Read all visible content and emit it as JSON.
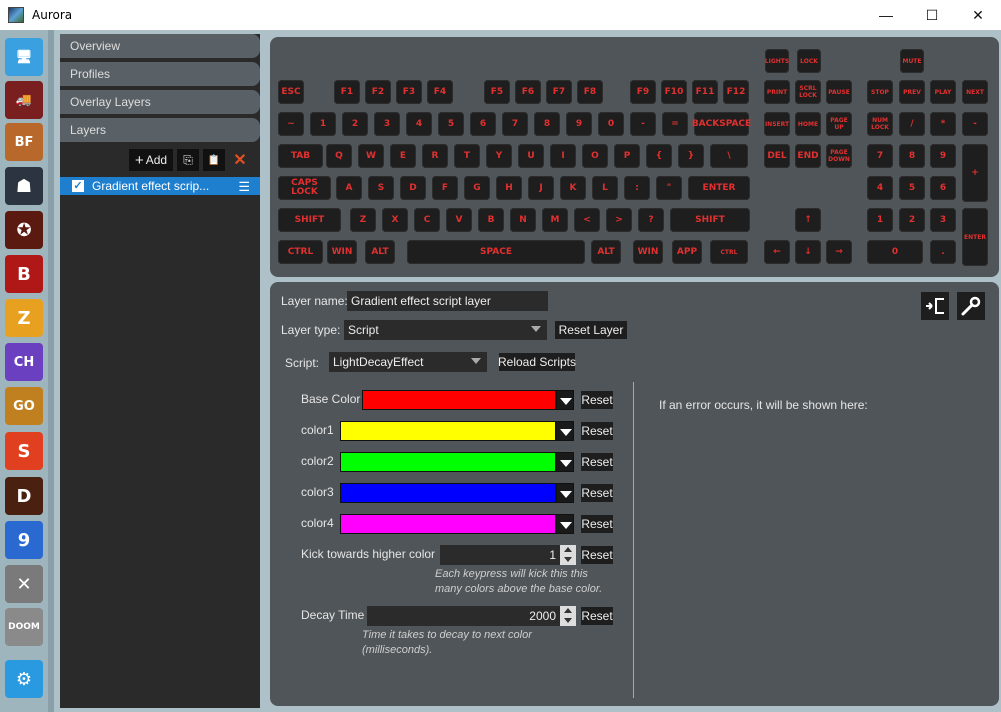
{
  "window": {
    "title": "Aurora",
    "controls": {
      "minimize": "—",
      "maximize": "☐",
      "close": "✕"
    }
  },
  "games": [
    {
      "name": "desktop-icon",
      "glyph": "🖥",
      "bg": "#3aa0e0"
    },
    {
      "name": "truck-icon",
      "glyph": "🚚",
      "bg": "#7a1f1f"
    },
    {
      "name": "battlefield-icon",
      "glyph": "BF",
      "bg": "#b8682a"
    },
    {
      "name": "soldier-icon",
      "glyph": "☗",
      "bg": "#2b3440"
    },
    {
      "name": "emblem-icon",
      "glyph": "✪",
      "bg": "#5a1a10"
    },
    {
      "name": "b-logo-icon",
      "glyph": "B",
      "bg": "#b01818"
    },
    {
      "name": "z-logo-icon",
      "glyph": "Z",
      "bg": "#e8a020"
    },
    {
      "name": "ch-logo-icon",
      "glyph": "CH",
      "bg": "#6a40c0"
    },
    {
      "name": "csgo-icon",
      "glyph": "GO",
      "bg": "#c08020"
    },
    {
      "name": "flame-icon",
      "glyph": "S",
      "bg": "#e04020"
    },
    {
      "name": "diablo-icon",
      "glyph": "D",
      "bg": "#4a2010"
    },
    {
      "name": "nine-logo-icon",
      "glyph": "9",
      "bg": "#2a6ad0"
    },
    {
      "name": "dishonored-icon",
      "glyph": "✕",
      "bg": "#7a7a7a"
    },
    {
      "name": "doom-icon",
      "glyph": "DOOM",
      "bg": "#8a8a8a"
    },
    {
      "name": "settings-gear-icon",
      "glyph": "⚙",
      "bg": "#2a9ae0"
    }
  ],
  "nav": {
    "overview": "Overview",
    "profiles": "Profiles",
    "overlay_layers": "Overlay Layers",
    "layers": "Layers"
  },
  "layer_toolbar": {
    "add": "Add",
    "add_glyph": "+",
    "copy_glyph": "⎘",
    "paste_glyph": "📋",
    "delete_glyph": "✕"
  },
  "layer_list": [
    {
      "name": "Gradient effect scrip...",
      "checked": true
    }
  ],
  "keyboard": {
    "row0": [
      "LIGHTS",
      "LOCK",
      "MUTE"
    ],
    "row1": [
      "ESC",
      "F1",
      "F2",
      "F3",
      "F4",
      "F5",
      "F6",
      "F7",
      "F8",
      "F9",
      "F10",
      "F11",
      "F12",
      "PRINT",
      "SCRL LOCK",
      "PAUSE",
      "STOP",
      "PREV",
      "PLAY",
      "NEXT"
    ],
    "row2": [
      "~",
      "1",
      "2",
      "3",
      "4",
      "5",
      "6",
      "7",
      "8",
      "9",
      "0",
      "-",
      "=",
      "BACKSPACE",
      "INSERT",
      "HOME",
      "PAGE UP",
      "NUM LOCK",
      "/",
      "*",
      "-"
    ],
    "row3": [
      "TAB",
      "Q",
      "W",
      "E",
      "R",
      "T",
      "Y",
      "U",
      "I",
      "O",
      "P",
      "{",
      "}",
      "\\",
      "DEL",
      "END",
      "PAGE DOWN",
      "7",
      "8",
      "9",
      "+"
    ],
    "row4": [
      "CAPS LOCK",
      "A",
      "S",
      "D",
      "F",
      "G",
      "H",
      "J",
      "K",
      "L",
      ":",
      "\"",
      "ENTER",
      "4",
      "5",
      "6"
    ],
    "row5": [
      "SHIFT",
      "Z",
      "X",
      "C",
      "V",
      "B",
      "N",
      "M",
      "<",
      ">",
      "?",
      "SHIFT",
      "↑",
      "1",
      "2",
      "3",
      "ENTER"
    ],
    "row6": [
      "CTRL",
      "WIN",
      "ALT",
      "SPACE",
      "ALT",
      "WIN",
      "APP",
      "CTRL",
      "←",
      "↓",
      "→",
      "0",
      "."
    ]
  },
  "settings": {
    "layer_name_label": "Layer name:",
    "layer_name_value": "Gradient effect script layer",
    "layer_type_label": "Layer type:",
    "layer_type_value": "Script",
    "reset_layer": "Reset Layer",
    "script_label": "Script:",
    "script_value": "LightDecayEffect",
    "reload_scripts": "Reload Scripts",
    "error_text": "If an error occurs, it will be shown here:",
    "reset": "Reset",
    "colors": [
      {
        "label": "Base Color",
        "hex": "#ff0000"
      },
      {
        "label": "color1",
        "hex": "#ffff00"
      },
      {
        "label": "color2",
        "hex": "#00ff00"
      },
      {
        "label": "color3",
        "hex": "#0000ff"
      },
      {
        "label": "color4",
        "hex": "#ff00ff"
      }
    ],
    "kick_label": "Kick towards higher color",
    "kick_value": "1",
    "kick_hint_1": "Each keypress will kick this this",
    "kick_hint_2": "many colors above the base color.",
    "decay_label": "Decay Time",
    "decay_value": "2000",
    "decay_hint_1": "Time it takes to decay to next color",
    "decay_hint_2": "(milliseconds)."
  }
}
